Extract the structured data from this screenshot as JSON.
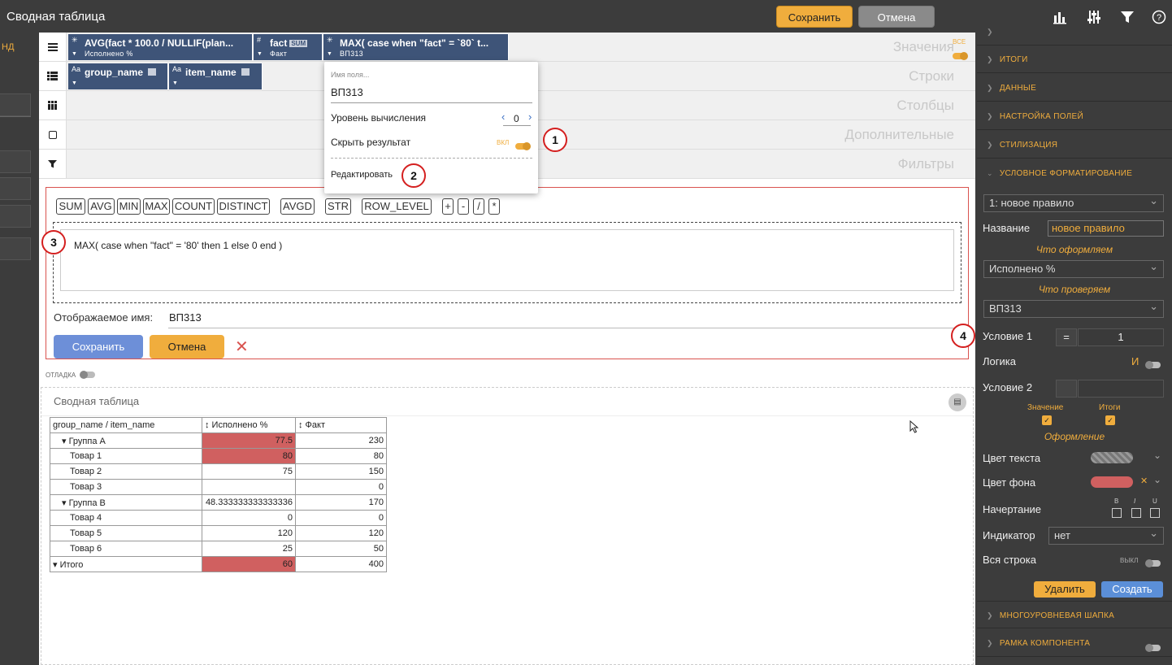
{
  "app": {
    "title": "Сводная таблица",
    "save": "Сохранить",
    "cancel": "Отмена"
  },
  "left": {
    "label": "НД"
  },
  "zones": {
    "values": "Значения",
    "rows": "Строки",
    "cols": "Столбцы",
    "extra": "Дополнительные",
    "filters": "Фильтры",
    "all_label": "ВСЕ",
    "value_chips": [
      {
        "title": "AVG(fact * 100.0 / NULLIF(plan...",
        "sub": "Исполнено %"
      },
      {
        "title": "fact",
        "tag": "SUM",
        "sub": "Факт"
      },
      {
        "title": "MAX( case when \"fact\" = `80` t...",
        "sub": "ВП313"
      }
    ],
    "row_chips": [
      {
        "title": "group_name"
      },
      {
        "title": "item_name"
      }
    ]
  },
  "popup": {
    "field_label": "Имя поля...",
    "field_value": "ВП313",
    "calc_level": "Уровень вычисления",
    "calc_value": "0",
    "hide_result": "Скрыть результат",
    "hide_state": "ВКЛ",
    "edit": "Редактировать"
  },
  "badges": [
    "1",
    "2",
    "3",
    "4"
  ],
  "editor": {
    "funcs": [
      "SUM",
      "AVG",
      "MIN",
      "MAX",
      "COUNT",
      "DISTINCT",
      "AVGD",
      "STR",
      "ROW_LEVEL",
      "+",
      "-",
      "/",
      "*"
    ],
    "expression": "MAX( case when \"fact\" = '80' then 1 else 0 end  )",
    "display_label": "Отображаемое имя:",
    "display_value": "ВП313",
    "save": "Сохранить",
    "cancel": "Отмена",
    "close": "✕"
  },
  "debug": "ОТЛАДКА",
  "pivot": {
    "title": "Сводная таблица",
    "headers": [
      "group_name / item_name",
      "↕ Исполнено %",
      "↕ Факт"
    ],
    "rows": [
      {
        "label": "Группа A",
        "level": 1,
        "v1": "77.5",
        "v2": "230",
        "hl": true
      },
      {
        "label": "Товар 1",
        "level": 2,
        "v1": "80",
        "v2": "80",
        "hl": true
      },
      {
        "label": "Товар 2",
        "level": 2,
        "v1": "75",
        "v2": "150",
        "hl": false
      },
      {
        "label": "Товар 3",
        "level": 2,
        "v1": "",
        "v2": "0",
        "hl": false
      },
      {
        "label": "Группа B",
        "level": 1,
        "v1": "48.333333333333336",
        "v2": "170",
        "hl": false
      },
      {
        "label": "Товар 4",
        "level": 2,
        "v1": "0",
        "v2": "0",
        "hl": false
      },
      {
        "label": "Товар 5",
        "level": 2,
        "v1": "120",
        "v2": "120",
        "hl": false
      },
      {
        "label": "Товар 6",
        "level": 2,
        "v1": "25",
        "v2": "50",
        "hl": false
      },
      {
        "label": "Итого",
        "level": 0,
        "v1": "60",
        "v2": "400",
        "hl": true
      }
    ]
  },
  "right": {
    "sections_top": [
      "ИТОГИ",
      "ДАННЫЕ",
      "НАСТРОЙКА ПОЛЕЙ",
      "СТИЛИЗАЦИЯ"
    ],
    "cond_section": "УСЛОВНОЕ ФОРМАТИРОВАНИЕ",
    "rule_select": "1: новое правило",
    "name_label": "Название",
    "name_value": "новое правило",
    "what_format": "Что оформляем",
    "format_select": "Исполнено %",
    "what_check": "Что проверяем",
    "check_select": "ВП313",
    "cond1_label": "Условие 1",
    "cond1_op": "=",
    "cond1_value": "1",
    "logic_label": "Логика",
    "logic_value": "И",
    "cond2_label": "Условие 2",
    "value_label": "Значение",
    "totals_label": "Итоги",
    "formatting": "Оформление",
    "text_color_label": "Цвет текста",
    "bg_color_label": "Цвет фона",
    "bg_color": "#d06060",
    "style_label": "Начертание",
    "style_b": "B",
    "style_i": "I",
    "style_u": "U",
    "indicator_label": "Индикатор",
    "indicator_value": "нет",
    "whole_row_label": "Вся строка",
    "whole_row_state": "ВЫКЛ",
    "delete": "Удалить",
    "create": "Создать",
    "sections_bottom": [
      "МНОГОУРОВНЕВАЯ ШАПКА",
      "РАМКА КОМПОНЕНТА"
    ]
  }
}
